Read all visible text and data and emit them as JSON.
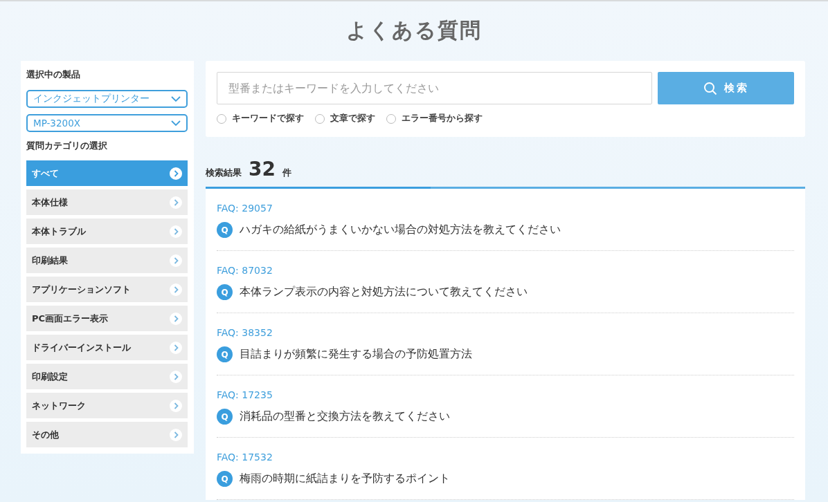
{
  "page_title": "よくある質問",
  "sidebar": {
    "product_heading": "選択中の製品",
    "selects": [
      {
        "value": "インクジェットプリンター"
      },
      {
        "value": "MP-3200X"
      }
    ],
    "category_heading": "質問カテゴリの選択",
    "categories": [
      {
        "label": "すべて",
        "selected": true
      },
      {
        "label": "本体仕様",
        "selected": false
      },
      {
        "label": "本体トラブル",
        "selected": false
      },
      {
        "label": "印刷結果",
        "selected": false
      },
      {
        "label": "アプリケーションソフト",
        "selected": false
      },
      {
        "label": "PC画面エラー表示",
        "selected": false
      },
      {
        "label": "ドライバーインストール",
        "selected": false
      },
      {
        "label": "印刷設定",
        "selected": false
      },
      {
        "label": "ネットワーク",
        "selected": false
      },
      {
        "label": "その他",
        "selected": false
      }
    ]
  },
  "search": {
    "placeholder": "型番またはキーワードを入力してください",
    "button": "検索",
    "modes": [
      {
        "label": "キーワードで探す",
        "selected": false
      },
      {
        "label": "文章で探す",
        "selected": false
      },
      {
        "label": "エラー番号から探す",
        "selected": false
      }
    ]
  },
  "results": {
    "label": "検索結果",
    "count": "32",
    "unit": "件",
    "items": [
      {
        "id": "FAQ: 29057",
        "badge": "Q",
        "question": "ハガキの給紙がうまくいかない場合の対処方法を教えてください"
      },
      {
        "id": "FAQ: 87032",
        "badge": "Q",
        "question": "本体ランプ表示の内容と対処方法について教えてください"
      },
      {
        "id": "FAQ: 38352",
        "badge": "Q",
        "question": "目詰まりが頻繁に発生する場合の予防処置方法"
      },
      {
        "id": "FAQ: 17235",
        "badge": "Q",
        "question": "消耗品の型番と交換方法を教えてください"
      },
      {
        "id": "FAQ: 17532",
        "badge": "Q",
        "question": "梅雨の時期に紙詰まりを予防するポイント"
      }
    ]
  }
}
